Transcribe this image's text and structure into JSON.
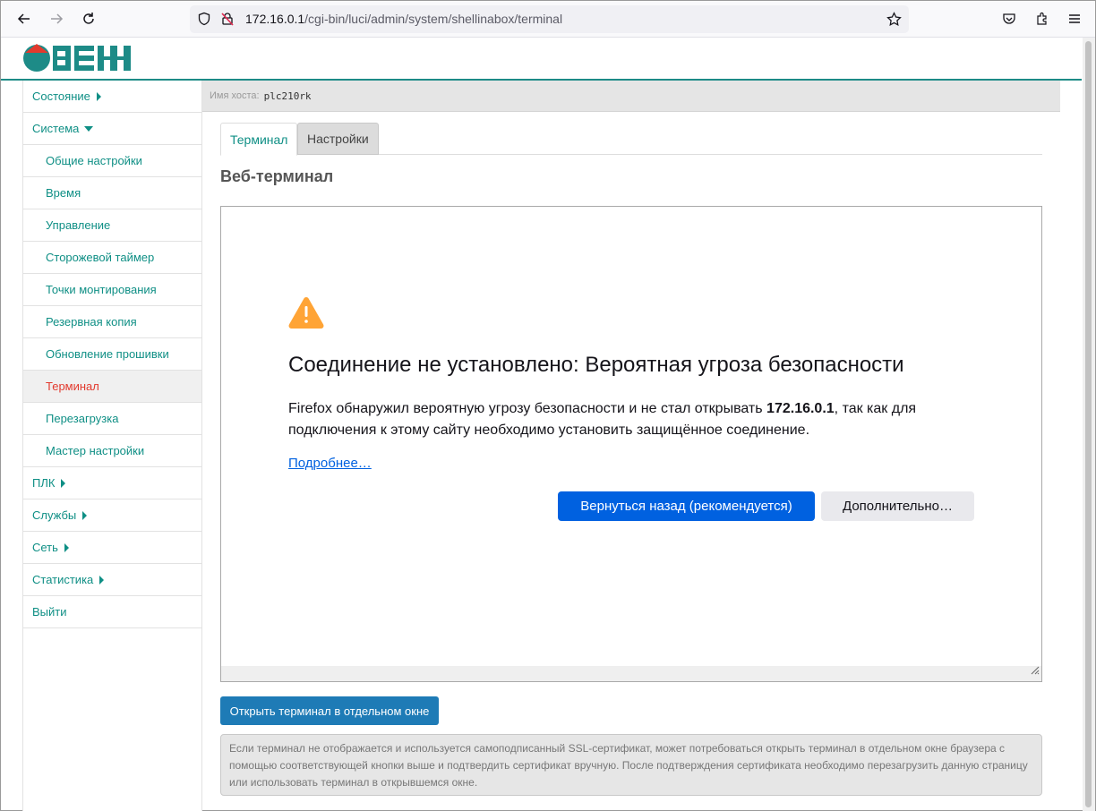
{
  "browser": {
    "url_host": "172.16.0.1",
    "url_path": "/cgi-bin/luci/admin/system/shellinabox/terminal"
  },
  "sidebar": {
    "items": [
      {
        "label": "Состояние",
        "type": "top",
        "arrow": "right"
      },
      {
        "label": "Система",
        "type": "top",
        "arrow": "down"
      },
      {
        "label": "Общие настройки",
        "type": "sub"
      },
      {
        "label": "Время",
        "type": "sub"
      },
      {
        "label": "Управление",
        "type": "sub"
      },
      {
        "label": "Сторожевой таймер",
        "type": "sub"
      },
      {
        "label": "Точки монтирования",
        "type": "sub"
      },
      {
        "label": "Резервная копия",
        "type": "sub"
      },
      {
        "label": "Обновление прошивки",
        "type": "sub"
      },
      {
        "label": "Терминал",
        "type": "sub",
        "active": true
      },
      {
        "label": "Перезагрузка",
        "type": "sub"
      },
      {
        "label": "Мастер настройки",
        "type": "sub"
      },
      {
        "label": "ПЛК",
        "type": "top",
        "arrow": "right"
      },
      {
        "label": "Службы",
        "type": "top",
        "arrow": "right"
      },
      {
        "label": "Сеть",
        "type": "top",
        "arrow": "right"
      },
      {
        "label": "Статистика",
        "type": "top",
        "arrow": "right"
      },
      {
        "label": "Выйти",
        "type": "top"
      }
    ]
  },
  "hostbar": {
    "label": "Имя хоста:",
    "value": "plc210rk"
  },
  "tabs": {
    "terminal": "Терминал",
    "settings": "Настройки"
  },
  "section_title": "Веб-терминал",
  "error_page": {
    "title": "Соединение не установлено: Вероятная угроза безопасности",
    "text_before": "Firefox обнаружил вероятную угрозу безопасности и не стал открывать ",
    "host": "172.16.0.1",
    "text_after": ", так как для подключения к этому сайту необходимо установить защищённое соединение.",
    "learn_more": "Подробнее…",
    "go_back": "Вернуться назад (рекомендуется)",
    "advanced": "Дополнительно…"
  },
  "open_button": "Открыть терминал в отдельном окне",
  "note": "Если терминал не отображается и используется самоподписанный SSL-сертификат, может потребоваться открыть терминал в отдельном окне браузера с помощью соответствующей кнопки выше и подтвердить сертификат вручную. После подтверждения сертификата необходимо перезагрузить данную страницу или использовать терминал в открывшемся окне.",
  "colors": {
    "accent": "#0f8f85",
    "active": "#e23a2e",
    "firefox_blue": "#0061e0",
    "button_blue": "#1e7bb6"
  }
}
